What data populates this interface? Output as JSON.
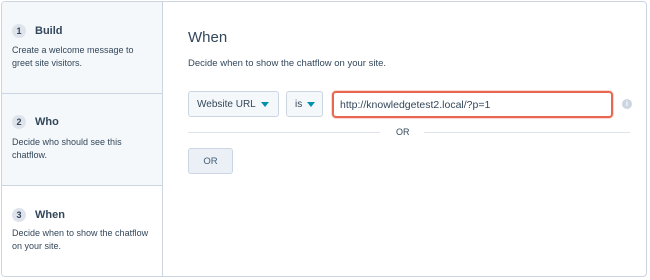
{
  "sidebar": {
    "steps": [
      {
        "number": "1",
        "title": "Build",
        "description": "Create a welcome message to greet site visitors."
      },
      {
        "number": "2",
        "title": "Who",
        "description": "Decide who should see this chatflow."
      },
      {
        "number": "3",
        "title": "When",
        "description": "Decide when to show the chatflow on your site."
      }
    ]
  },
  "main": {
    "title": "When",
    "description": "Decide when to show the chatflow on your site.",
    "rule": {
      "field": "Website URL",
      "operator": "is",
      "value": "http://knowledgetest2.local/?p=1"
    },
    "divider_label": "OR",
    "or_button_label": "OR"
  },
  "colors": {
    "accent_caret": "#0091ae",
    "highlight_border": "#e8684f",
    "inactive_step_bg": "#f5f8fa"
  }
}
